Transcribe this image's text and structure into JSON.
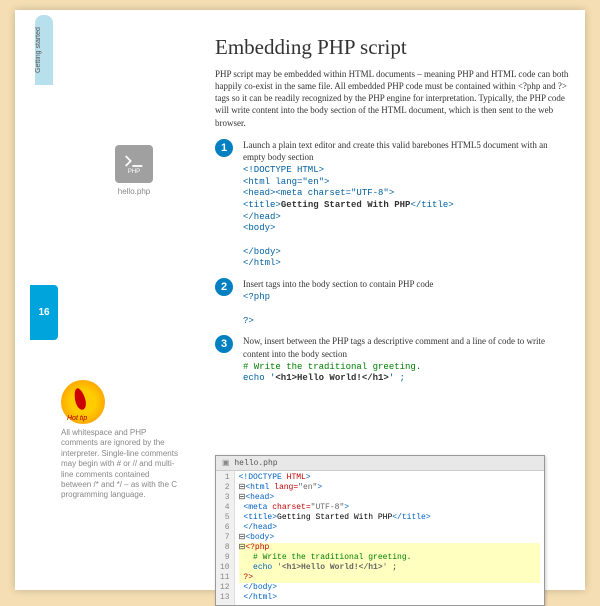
{
  "tabTop": "Getting started",
  "pageNum": "16",
  "title": "Embedding PHP script",
  "intro": "PHP script may be embedded within HTML documents – meaning PHP and HTML code can both happily co-exist in the same file. All embedded PHP code must be contained within <?php and ?> tags so it can be readily recognized by the PHP engine for interpretation. Typically, the PHP code will write content into the body section of the HTML document, which is then sent to the web browser.",
  "icon": {
    "label": "PHP",
    "caption": "hello.php"
  },
  "steps": [
    {
      "n": "1",
      "text": "Launch a plain text editor and create this valid barebones HTML5 document with an empty body section",
      "code": "<!DOCTYPE HTML>\n<html lang=\"en\">\n<head><meta charset=\"UTF-8\">\n<title><b>Getting Started With PHP</b></title>\n</head>\n<body>\n\n</body>\n</html>"
    },
    {
      "n": "2",
      "text": "Insert tags into the body section to contain PHP code",
      "code": "<?php\n\n?>"
    },
    {
      "n": "3",
      "text": "Now, insert between the PHP tags a descriptive comment and a line of code to write content into the body section",
      "code": "<span class=grn># Write the traditional greeting.</span>\necho '<b><h1>Hello World!</h1></b>' ;"
    }
  ],
  "tip": {
    "label": "Hot tip",
    "text": "All whitespace and PHP comments are ignored by the interpreter. Single-line comments may begin with # or // and multi-line comments contained between /* and */ – as with the C programming language."
  },
  "editor": {
    "tab": "hello.php",
    "gutter": [
      "1",
      "2",
      "3",
      "4",
      "5",
      "6",
      "7",
      "8",
      "9",
      "10",
      "11",
      "12",
      "13"
    ],
    "lines": [
      {
        "h": "<span class=blue>&lt;!DOCTYPE</span> <span class=red>HTML</span><span class=blue>&gt;</span>"
      },
      {
        "h": "⊟<span class=blue>&lt;html</span> <span class=red>lang=</span><span class=gray>\"en\"</span><span class=blue>&gt;</span>"
      },
      {
        "h": "⊟<span class=blue>&lt;head&gt;</span>"
      },
      {
        "h": " <span class=blue>&lt;meta</span> <span class=red>charset=</span><span class=gray>\"UTF-8\"</span><span class=blue>&gt;</span>"
      },
      {
        "h": " <span class=blue>&lt;title&gt;</span><span class=black>Getting Started With PHP</span><span class=blue>&lt;/title&gt;</span>"
      },
      {
        "h": " <span class=blue>&lt;/head&gt;</span>"
      },
      {
        "h": "⊟<span class=blue>&lt;body&gt;</span>"
      },
      {
        "h": "⊟<span class=red>&lt;?php</span>",
        "hl": true
      },
      {
        "h": "   <span class=green># Write the traditional greeting.</span>",
        "hl": true
      },
      {
        "h": "   <span class=blue>echo</span> <span class=gray>'<b>&lt;h1&gt;Hello World!&lt;/h1&gt;</b>'</span> ;",
        "hl": true
      },
      {
        "h": " <span class=red>?&gt;</span>",
        "hl": true
      },
      {
        "h": " <span class=blue>&lt;/body&gt;</span>"
      },
      {
        "h": " <span class=blue>&lt;/html&gt;</span>"
      }
    ]
  }
}
